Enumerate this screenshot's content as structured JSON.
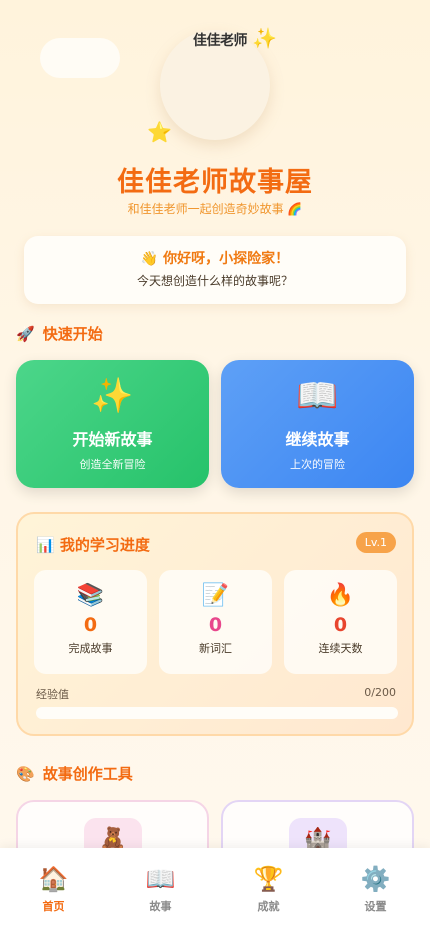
{
  "header": {
    "brand": "佳佳老师",
    "title": "佳佳老师故事屋",
    "subtitle": "和佳佳老师一起创造奇妙故事 🌈"
  },
  "greeting": {
    "line1": "👋 你好呀，小探险家！",
    "line2": "今天想创造什么样的故事呢？"
  },
  "quick_start": {
    "icon": "🚀",
    "title": "快速开始",
    "cards": [
      {
        "icon": "✨",
        "title": "开始新故事",
        "subtitle": "创造全新冒险",
        "color": "#2fca74"
      },
      {
        "icon": "📖",
        "title": "继续故事",
        "subtitle": "上次的冒险",
        "color": "#4a90f4"
      }
    ]
  },
  "progress": {
    "icon": "📊",
    "title": "我的学习进度",
    "level": "Lv.1",
    "stats": [
      {
        "icon": "📚",
        "value": "0",
        "label": "完成故事",
        "color": "#f36b12"
      },
      {
        "icon": "📝",
        "value": "0",
        "label": "新词汇",
        "color": "#e8478c"
      },
      {
        "icon": "🔥",
        "value": "0",
        "label": "连续天数",
        "color": "#e8452e"
      }
    ],
    "xp_label": "经验值",
    "xp_value": "0/200",
    "xp_fraction": 0
  },
  "tools": {
    "icon": "🎨",
    "title": "故事创作工具",
    "items": [
      {
        "icon": "🧸",
        "bg": "#fbe3ee"
      },
      {
        "icon": "🏰",
        "bg": "#eee3fb"
      }
    ]
  },
  "nav": {
    "items": [
      {
        "icon": "🏠",
        "label": "首页",
        "active": true
      },
      {
        "icon": "📖",
        "label": "故事",
        "active": false
      },
      {
        "icon": "🏆",
        "label": "成就",
        "active": false
      },
      {
        "icon": "⚙️",
        "label": "设置",
        "active": false
      }
    ]
  }
}
